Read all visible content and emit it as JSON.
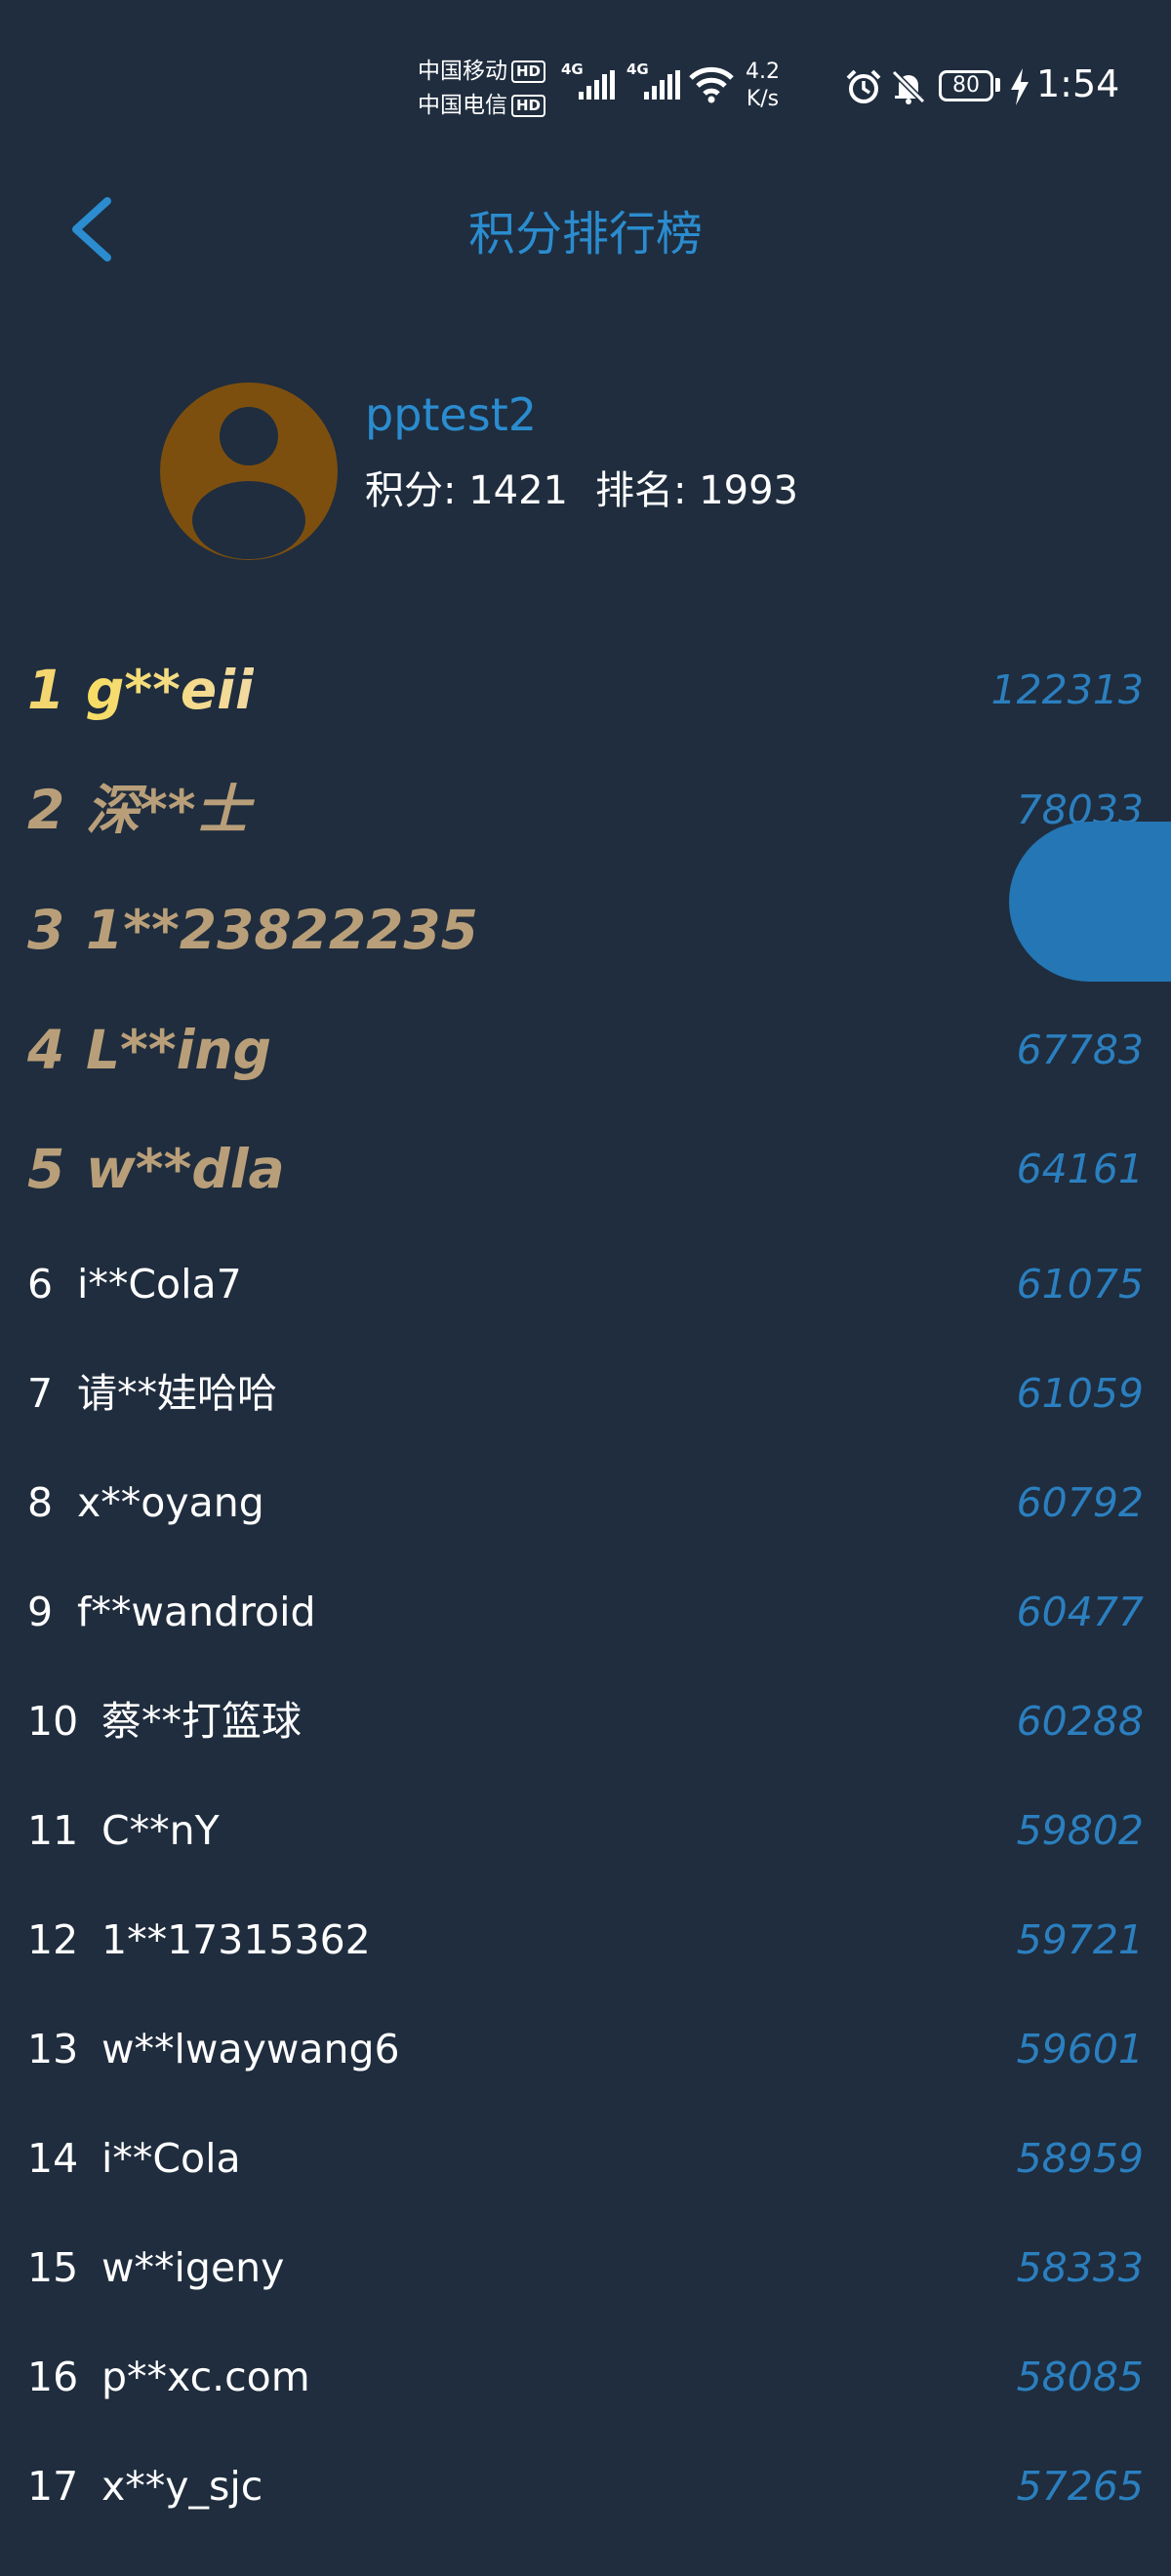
{
  "status_bar": {
    "carrier_1": "中国移动",
    "carrier_2": "中国电信",
    "hd_badge": "HD",
    "network_label": "4G",
    "speed_value": "4.2",
    "speed_unit": "K/s",
    "battery": "80",
    "time": "1:54"
  },
  "header": {
    "title": "积分排行榜"
  },
  "profile": {
    "username": "pptest2",
    "points_label": "积分:",
    "points": "1421",
    "rank_label": "排名:",
    "rank": "1993"
  },
  "leaderboard": [
    {
      "rank": "1",
      "name": "g**eii",
      "score": "122313"
    },
    {
      "rank": "2",
      "name": "深**士",
      "score": "78033"
    },
    {
      "rank": "3",
      "name": "1**23822235",
      "score": ""
    },
    {
      "rank": "4",
      "name": "L**ing",
      "score": "67783"
    },
    {
      "rank": "5",
      "name": "w**dla",
      "score": "64161"
    },
    {
      "rank": "6",
      "name": "i**Cola7",
      "score": "61075"
    },
    {
      "rank": "7",
      "name": "请**娃哈哈",
      "score": "61059"
    },
    {
      "rank": "8",
      "name": "x**oyang",
      "score": "60792"
    },
    {
      "rank": "9",
      "name": "f**wandroid",
      "score": "60477"
    },
    {
      "rank": "10",
      "name": "蔡**打篮球",
      "score": "60288"
    },
    {
      "rank": "11",
      "name": "C**nY",
      "score": "59802"
    },
    {
      "rank": "12",
      "name": "1**17315362",
      "score": "59721"
    },
    {
      "rank": "13",
      "name": "w**lwaywang6",
      "score": "59601"
    },
    {
      "rank": "14",
      "name": "i**Cola",
      "score": "58959"
    },
    {
      "rank": "15",
      "name": "w**igeny",
      "score": "58333"
    },
    {
      "rank": "16",
      "name": "p**xc.com",
      "score": "58085"
    },
    {
      "rank": "17",
      "name": "x**y_sjc",
      "score": "57265"
    }
  ],
  "colors": {
    "background": "#1f2d3e",
    "accent": "#2b8ccf",
    "gold": "#f3d66f",
    "bronze": "#b99f79",
    "avatar_bg": "#7d4f0f"
  }
}
